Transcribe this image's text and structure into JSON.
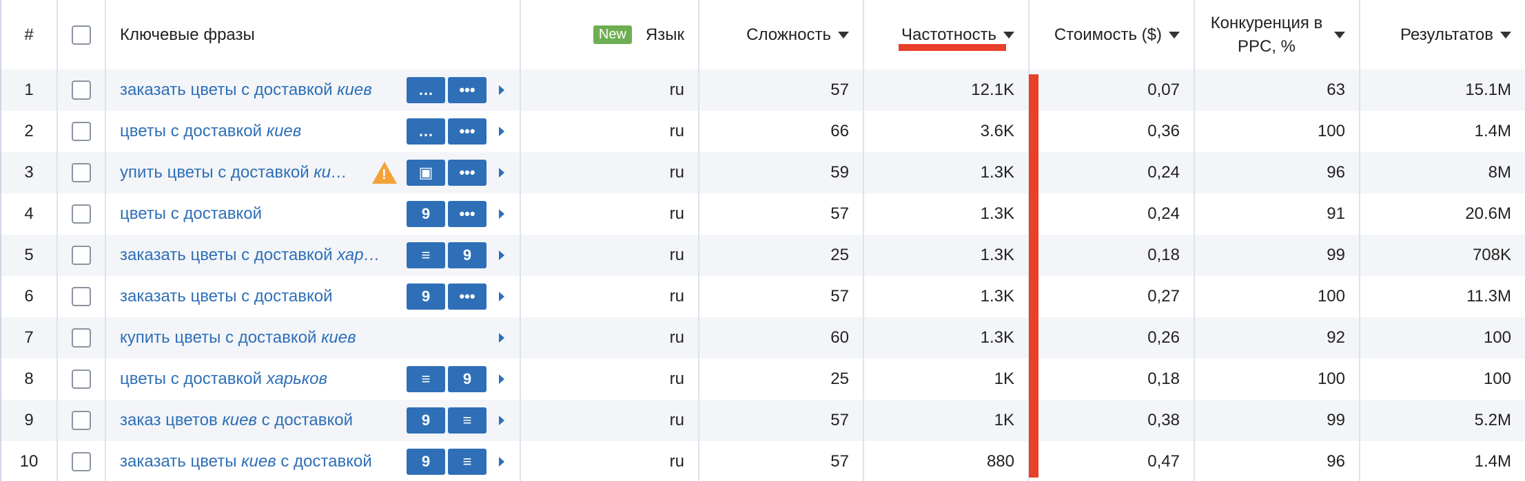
{
  "header": {
    "index": "#",
    "keywords": "Ключевые фразы",
    "new_badge": "New",
    "language": "Язык",
    "difficulty": "Сложность",
    "frequency": "Частотность",
    "cost": "Стоимость ($)",
    "competition": "Конкуренция в PPC, %",
    "results": "Результатов"
  },
  "rows": [
    {
      "n": "1",
      "kw": "заказать цветы с доставкой",
      "kw_it": "киев",
      "kw_after": "",
      "tools": [
        "chat-icon",
        "more-icon"
      ],
      "warn": false,
      "lang": "ru",
      "diff": "57",
      "freq": "12.1K",
      "cost": "0,07",
      "comp": "63",
      "res": "15.1M"
    },
    {
      "n": "2",
      "kw": "цветы с доставкой",
      "kw_it": "киев",
      "kw_after": "",
      "tools": [
        "chat-icon",
        "more-icon"
      ],
      "warn": false,
      "lang": "ru",
      "diff": "66",
      "freq": "3.6K",
      "cost": "0,36",
      "comp": "100",
      "res": "1.4M"
    },
    {
      "n": "3",
      "kw": "упить цветы с доставкой",
      "kw_it": "ки…",
      "kw_after": "",
      "tools": [
        "shop-icon",
        "more-icon"
      ],
      "warn": true,
      "lang": "ru",
      "diff": "59",
      "freq": "1.3K",
      "cost": "0,24",
      "comp": "96",
      "res": "8M"
    },
    {
      "n": "4",
      "kw": "цветы с доставкой",
      "kw_it": "",
      "kw_after": "",
      "tools": [
        "location-icon",
        "more-icon"
      ],
      "warn": false,
      "lang": "ru",
      "diff": "57",
      "freq": "1.3K",
      "cost": "0,24",
      "comp": "91",
      "res": "20.6M"
    },
    {
      "n": "5",
      "kw": "заказать цветы с доставкой",
      "kw_it": "хар…",
      "kw_after": "",
      "tools": [
        "list-icon",
        "location-icon"
      ],
      "warn": false,
      "lang": "ru",
      "diff": "25",
      "freq": "1.3K",
      "cost": "0,18",
      "comp": "99",
      "res": "708K"
    },
    {
      "n": "6",
      "kw": "заказать цветы с доставкой",
      "kw_it": "",
      "kw_after": "",
      "tools": [
        "location-icon",
        "more-icon"
      ],
      "warn": false,
      "lang": "ru",
      "diff": "57",
      "freq": "1.3K",
      "cost": "0,27",
      "comp": "100",
      "res": "11.3M"
    },
    {
      "n": "7",
      "kw": "купить цветы с доставкой",
      "kw_it": "киев",
      "kw_after": "",
      "tools": [],
      "warn": false,
      "lang": "ru",
      "diff": "60",
      "freq": "1.3K",
      "cost": "0,26",
      "comp": "92",
      "res": "100"
    },
    {
      "n": "8",
      "kw": "цветы с доставкой",
      "kw_it": "харьков",
      "kw_after": "",
      "tools": [
        "list-icon",
        "location-icon"
      ],
      "warn": false,
      "lang": "ru",
      "diff": "25",
      "freq": "1K",
      "cost": "0,18",
      "comp": "100",
      "res": "100"
    },
    {
      "n": "9",
      "kw": "заказ цветов",
      "kw_it": "киев",
      "kw_after": "с доставкой",
      "tools": [
        "location-icon",
        "list-icon"
      ],
      "warn": false,
      "lang": "ru",
      "diff": "57",
      "freq": "1K",
      "cost": "0,38",
      "comp": "99",
      "res": "5.2M"
    },
    {
      "n": "10",
      "kw": "заказать цветы",
      "kw_it": "киев",
      "kw_after": "с доставкой",
      "tools": [
        "location-icon",
        "list-icon"
      ],
      "warn": false,
      "lang": "ru",
      "diff": "57",
      "freq": "880",
      "cost": "0,47",
      "comp": "96",
      "res": "1.4M"
    }
  ],
  "colors": {
    "accent": "#2e6fb7",
    "highlight": "#e8402a",
    "new_badge": "#6eae52",
    "warning": "#f3a23a"
  }
}
